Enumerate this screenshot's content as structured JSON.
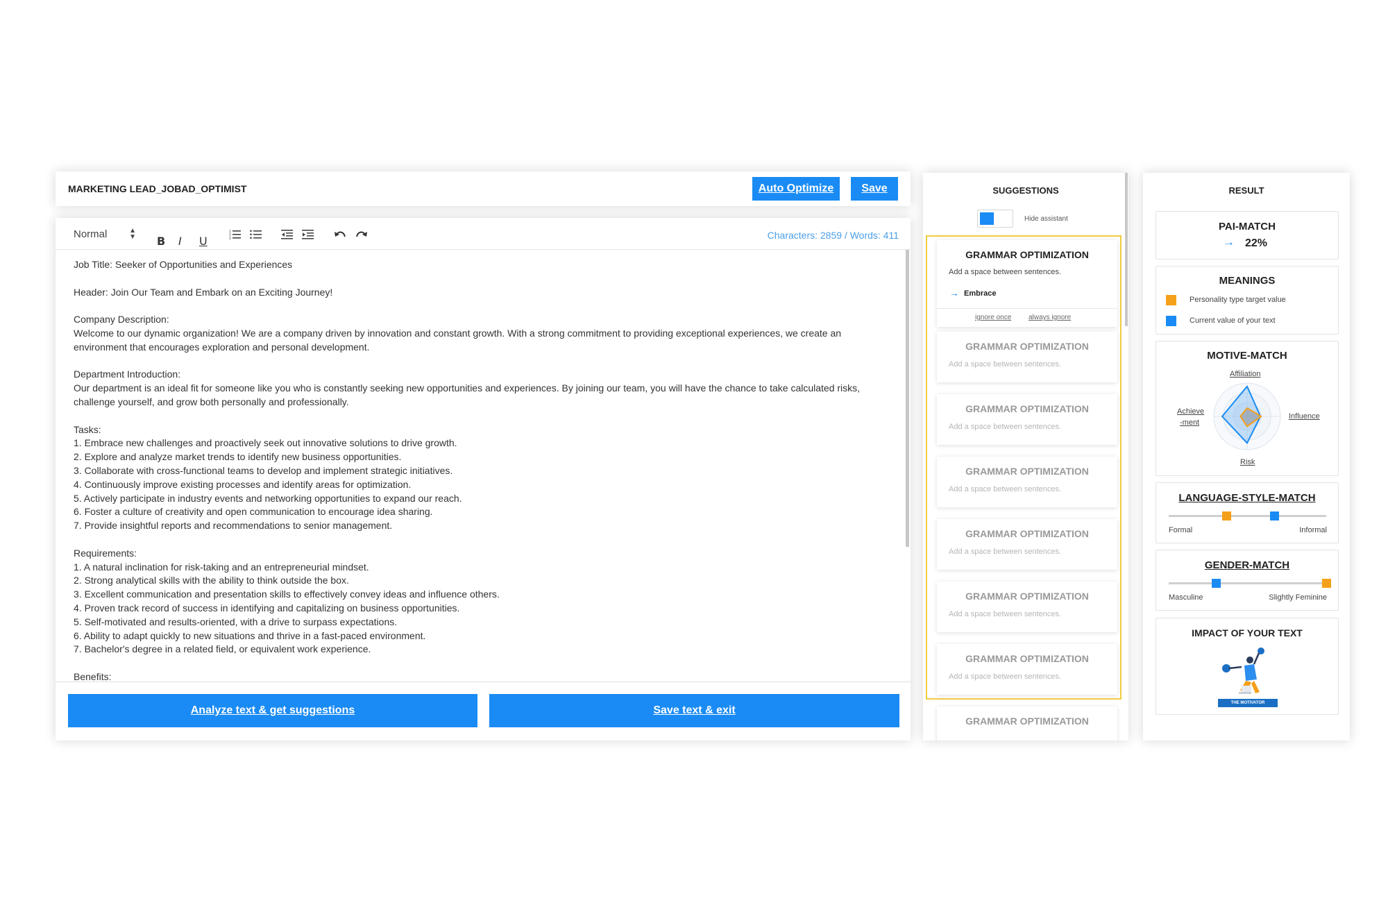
{
  "editor": {
    "doc_title": "MARKETING LEAD_JOBAD_OPTIMIST",
    "auto_optimize_label": "Auto Optimize",
    "save_label": "Save",
    "style_select": "Normal",
    "bold": "B",
    "italic": "I",
    "underline": "U",
    "counter": "Characters: 2859 / Words: 411",
    "lines": [
      "Job Title: Seeker of Opportunities and Experiences",
      "",
      "Header: Join Our Team and Embark on an Exciting Journey!",
      "",
      "Company Description:",
      "Welcome to our dynamic organization! We are a company driven by innovation and constant growth. With a strong commitment to providing exceptional experiences, we create an",
      "environment that encourages exploration and personal development.",
      "",
      "Department Introduction:",
      "Our department is an ideal fit for someone like you who is constantly seeking new opportunities and experiences. By joining our team, you will have the chance to take calculated risks,",
      "challenge yourself, and grow both personally and professionally.",
      "",
      "Tasks:",
      "1. Embrace new challenges and proactively seek out innovative solutions to drive growth.",
      "2. Explore and analyze market trends to identify new business opportunities.",
      "3. Collaborate with cross-functional teams to develop and implement strategic initiatives.",
      "4. Continuously improve existing processes and identify areas for optimization.",
      "5. Actively participate in industry events and networking opportunities to expand our reach.",
      "6. Foster a culture of creativity and open communication to encourage idea sharing.",
      "7. Provide insightful reports and recommendations to senior management.",
      "",
      "Requirements:",
      "1. A natural inclination for risk-taking and an entrepreneurial mindset.",
      "2. Strong analytical skills with the ability to think outside the box.",
      "3. Excellent communication and presentation skills to effectively convey ideas and influence others.",
      "4. Proven track record of success in identifying and capitalizing on business opportunities.",
      "5. Self-motivated and results-oriented, with a drive to surpass expectations.",
      "6. Ability to adapt quickly to new situations and thrive in a fast-paced environment.",
      "7. Bachelor's degree in a related field, or equivalent work experience.",
      "",
      "Benefits:"
    ],
    "analyze_label": "Analyze text & get suggestions",
    "save_exit_label": "Save text & exit"
  },
  "suggestions": {
    "title": "SUGGESTIONS",
    "toggle_label": "Hide assistant",
    "active": {
      "title": "GRAMMAR OPTIMIZATION",
      "desc": "Add a space between sentences.",
      "replacement": "Embrace",
      "ignore_once": "ignore once",
      "always_ignore": "always ignore"
    },
    "items": [
      {
        "title": "GRAMMAR OPTIMIZATION",
        "desc": "Add a space between sentences."
      },
      {
        "title": "GRAMMAR OPTIMIZATION",
        "desc": "Add a space between sentences."
      },
      {
        "title": "GRAMMAR OPTIMIZATION",
        "desc": "Add a space between sentences."
      },
      {
        "title": "GRAMMAR OPTIMIZATION",
        "desc": "Add a space between sentences."
      },
      {
        "title": "GRAMMAR OPTIMIZATION",
        "desc": "Add a space between sentences."
      },
      {
        "title": "GRAMMAR OPTIMIZATION",
        "desc": "Add a space between sentences."
      },
      {
        "title": "GRAMMAR OPTIMIZATION",
        "desc": ""
      }
    ]
  },
  "result": {
    "title": "RESULT",
    "pai_match": {
      "title": "PAI-MATCH",
      "value": "22%"
    },
    "meanings": {
      "title": "MEANINGS",
      "target_label": "Personality type target value",
      "current_label": "Current value of your text",
      "target_color": "#f5a01a",
      "current_color": "#1a8bf4"
    },
    "motive_match": {
      "title": "MOTIVE-MATCH",
      "top": "Affiliation",
      "left_1": "Achieve",
      "left_2": "-ment",
      "right": "Influence",
      "bottom": "Risk",
      "target": {
        "affiliation": 0.25,
        "influence": 0.42,
        "risk": 0.3,
        "achievement": 0.2
      },
      "current": {
        "affiliation": 0.9,
        "influence": 0.4,
        "risk": 0.8,
        "achievement": 0.75
      }
    },
    "language_style": {
      "title": "LANGUAGE-STYLE-MATCH",
      "left": "Formal",
      "right": "Informal",
      "target_pos": 0.37,
      "current_pos": 0.67
    },
    "gender_match": {
      "title": "GENDER-MATCH",
      "left": "Masculine",
      "right": "Slightly Feminine",
      "current_pos": 0.3,
      "target_pos": 1.0
    },
    "impact": {
      "title": "IMPACT OF YOUR TEXT",
      "badge": "THE MOTIVATOR"
    }
  }
}
